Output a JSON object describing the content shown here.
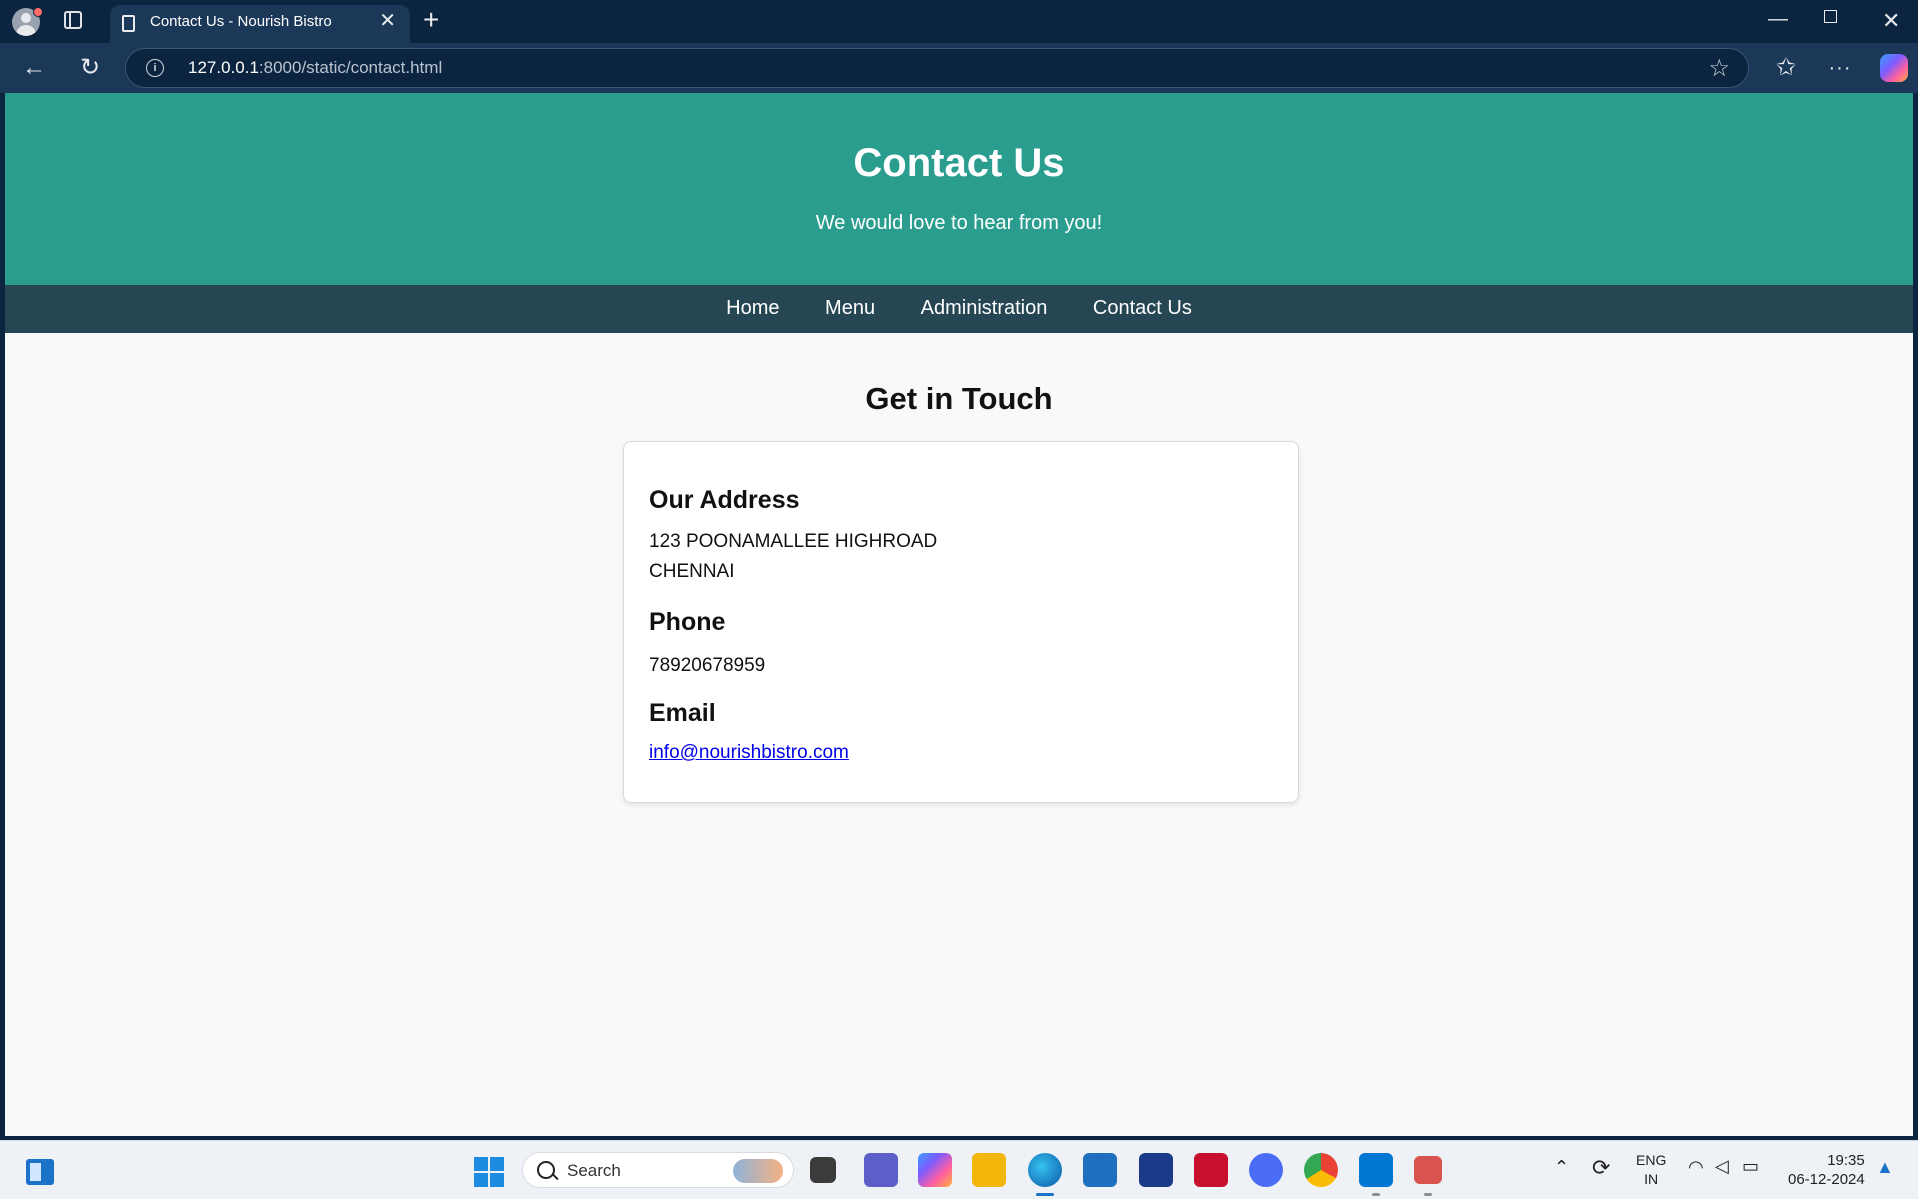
{
  "browser": {
    "tab_title": "Contact Us - Nourish Bistro",
    "tab_close": "✕",
    "new_tab": "+",
    "url_host": "127.0.0.1",
    "url_rest": ":8000/static/contact.html",
    "back_glyph": "←",
    "reload_glyph": "↻",
    "info_glyph": "i",
    "star_glyph": "☆",
    "fav_glyph": "✩",
    "more_glyph": "···",
    "min_glyph": "—",
    "close_glyph": "✕"
  },
  "header": {
    "title": "Contact Us",
    "tagline": "We would love to hear from you!"
  },
  "nav": {
    "items": [
      {
        "label": "Home"
      },
      {
        "label": "Menu"
      },
      {
        "label": "Administration"
      },
      {
        "label": "Contact Us"
      }
    ]
  },
  "main": {
    "section_title": "Get in Touch",
    "address": {
      "heading": "Our Address",
      "line1": "123 POONAMALLEE HIGHROAD",
      "line2": "CHENNAI"
    },
    "phone": {
      "heading": "Phone",
      "value": "78920678959"
    },
    "email": {
      "heading": "Email",
      "value": "info@nourishbistro.com"
    }
  },
  "taskbar": {
    "search_label": "Search",
    "lang_line1": "ENG",
    "lang_line2": "IN",
    "time": "19:35",
    "date": "06-12-2024"
  },
  "colors": {
    "header_bg": "#2a9d8f",
    "nav_bg": "#264653",
    "page_bg": "#f8f9fa",
    "link": "#0000ee"
  }
}
